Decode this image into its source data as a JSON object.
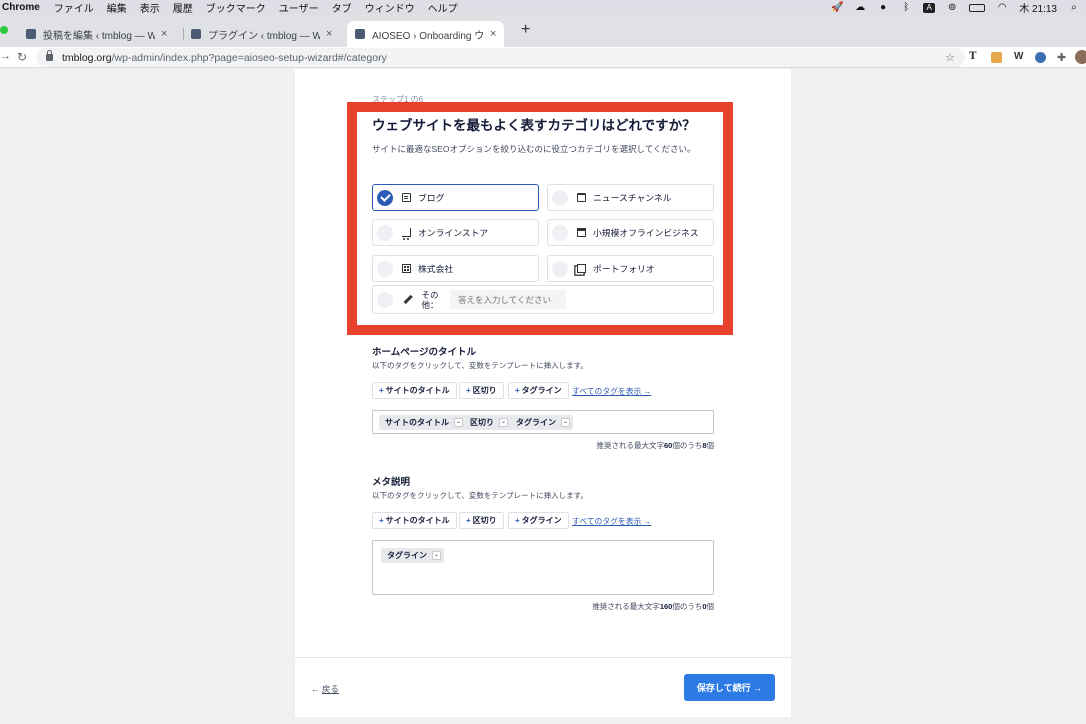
{
  "menubar": {
    "app": "Chrome",
    "items": [
      "ファイル",
      "編集",
      "表示",
      "履歴",
      "ブックマーク",
      "ユーザー",
      "タブ",
      "ウィンドウ",
      "ヘルプ"
    ],
    "clock": "木 21:13",
    "status_icons": [
      "rocket-icon",
      "cloud-icon",
      "cloud-dark-icon",
      "bluetooth-icon",
      "keyboard-a-icon",
      "link-icon",
      "battery-icon",
      "wifi-icon",
      "spotlight-icon"
    ]
  },
  "tabs": [
    {
      "title": "投稿を編集 ‹ tmblog — WordPress",
      "close": "×"
    },
    {
      "title": "プラグイン ‹ tmblog — WordPress",
      "close": "×"
    },
    {
      "title": "AIOSEO › Onboarding ウィザード",
      "close": "×",
      "active": true
    }
  ],
  "newtab": "+",
  "address": {
    "host": "tmblog.org",
    "path": "/wp-admin/index.php?page=aioseo-setup-wizard#/category"
  },
  "extensions": {
    "t": "T",
    "w": "W"
  },
  "wizard": {
    "step": "ステップ1 の6",
    "title": "ウェブサイトを最もよく表すカテゴリはどれですか？",
    "description": "サイトに最適なSEOオプションを絞り込むのに役立つカテゴリを選択してください。",
    "options": [
      {
        "label": "ブログ",
        "icon": "document-icon",
        "selected": true
      },
      {
        "label": "ニュースチャンネル",
        "icon": "calendar-icon",
        "selected": false
      },
      {
        "label": "オンラインストア",
        "icon": "cart-icon",
        "selected": false
      },
      {
        "label": "小規模オフラインビジネス",
        "icon": "store-icon",
        "selected": false
      },
      {
        "label": "株式会社",
        "icon": "building-icon",
        "selected": false
      },
      {
        "label": "ポートフォリオ",
        "icon": "gallery-icon",
        "selected": false
      }
    ],
    "other_label_1": "その",
    "other_label_2": "他：",
    "other_placeholder": "答えを入力してください",
    "accent_color": "#2c5bb5",
    "highlight_color": "#e8412b"
  },
  "homepage_title": {
    "heading": "ホームページのタイトル",
    "description": "以下のタグをクリックして、変数をテンプレートに挿入します。",
    "tag_buttons": [
      "サイトのタイトル",
      "区切り",
      "タグライン"
    ],
    "all_tags": "すべてのタグを表示 →",
    "chips": [
      "サイトのタイトル",
      "区切り",
      "タグライン"
    ],
    "counter_pre": "推奨される最大文字",
    "counter_max": "60",
    "counter_mid": "個のうち",
    "counter_used": "8",
    "counter_post": "個"
  },
  "meta_description": {
    "heading": "メタ説明",
    "description": "以下のタグをクリックして、変数をテンプレートに挿入します。",
    "tag_buttons": [
      "サイトのタイトル",
      "区切り",
      "タグライン"
    ],
    "all_tags": "すべてのタグを表示 →",
    "chips": [
      "タグライン"
    ],
    "counter_pre": "推奨される最大文字",
    "counter_max": "160",
    "counter_mid": "個のうち",
    "counter_used": "0",
    "counter_post": "個"
  },
  "footer": {
    "back_arrow": "←",
    "back_label": "戻る",
    "save_label": "保存して続行 →"
  }
}
